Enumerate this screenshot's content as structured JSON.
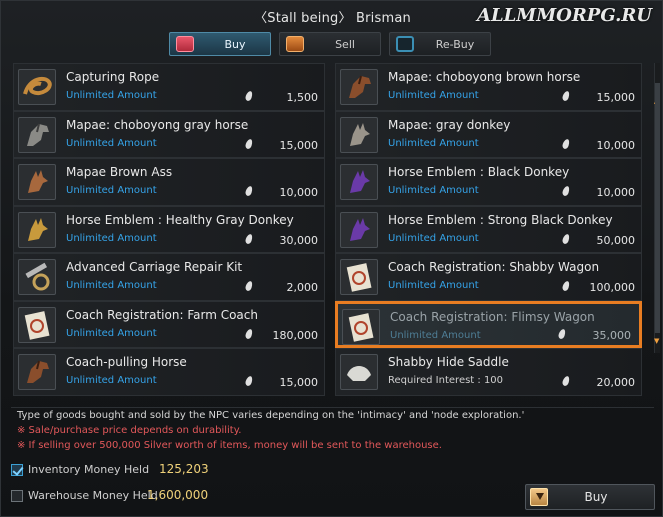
{
  "window": {
    "title": "〈Stall being〉 Brisman",
    "watermark": "ALLMMORPG.RU"
  },
  "tabs": [
    {
      "label": "Buy",
      "icon": "bag-icon",
      "active": true
    },
    {
      "label": "Sell",
      "icon": "coins-icon",
      "active": false
    },
    {
      "label": "Re-Buy",
      "icon": "rebuy-icon",
      "active": false
    }
  ],
  "items_left": [
    {
      "name": "Capturing Rope",
      "sub": "Unlimited Amount",
      "price": "1,500",
      "icon": "rope-icon"
    },
    {
      "name": "Mapae: choboyong gray horse",
      "sub": "Unlimited Amount",
      "price": "15,000",
      "icon": "gray-horse-icon"
    },
    {
      "name": "Mapae Brown Ass",
      "sub": "Unlimited Amount",
      "price": "10,000",
      "icon": "brown-donkey-icon"
    },
    {
      "name": "Horse Emblem : Healthy Gray Donkey",
      "sub": "Unlimited Amount",
      "price": "30,000",
      "icon": "gold-horse-emblem-icon"
    },
    {
      "name": "Advanced Carriage Repair Kit",
      "sub": "Unlimited Amount",
      "price": "2,000",
      "icon": "repair-kit-icon"
    },
    {
      "name": "Coach Registration: Farm Coach",
      "sub": "Unlimited Amount",
      "price": "180,000",
      "icon": "coach-registration-icon"
    },
    {
      "name": "Coach-pulling Horse",
      "sub": "Unlimited Amount",
      "price": "15,000",
      "icon": "brown-horse-icon"
    }
  ],
  "items_right": [
    {
      "name": "Mapae: choboyong brown horse",
      "sub": "Unlimited Amount",
      "price": "15,000",
      "icon": "brown-horse-icon"
    },
    {
      "name": "Mapae: gray donkey",
      "sub": "Unlimited Amount",
      "price": "10,000",
      "icon": "gray-donkey-icon"
    },
    {
      "name": "Horse Emblem : Black Donkey",
      "sub": "Unlimited Amount",
      "price": "10,000",
      "icon": "purple-horse-emblem-icon"
    },
    {
      "name": "Horse Emblem : Strong Black Donkey",
      "sub": "Unlimited Amount",
      "price": "50,000",
      "icon": "purple-horse-emblem-icon"
    },
    {
      "name": "Coach Registration: Shabby Wagon",
      "sub": "Unlimited Amount",
      "price": "100,000",
      "icon": "coach-registration-icon"
    },
    {
      "name": "Coach Registration: Flimsy Wagon",
      "sub": "Unlimited Amount",
      "price": "35,000",
      "icon": "coach-registration-icon",
      "highlight": true
    },
    {
      "name": "Shabby Hide Saddle",
      "sub": "Required Interest : 100",
      "price": "20,000",
      "icon": "saddle-icon"
    }
  ],
  "info": {
    "line1": "Type of goods bought and sold by the NPC varies depending on the 'intimacy' and 'node exploration.'",
    "line2": "※ Sale/purchase price depends on durability.",
    "line3": "※ If selling over 500,000 Silver worth of items, money will be sent to the warehouse."
  },
  "money": {
    "inventory_label": "Inventory Money Held",
    "inventory_value": "125,203",
    "inventory_checked": true,
    "warehouse_label": "Warehouse Money Held",
    "warehouse_value": "1,600,000",
    "warehouse_checked": false
  },
  "buy_button": {
    "label": "Buy",
    "icon": "buy-arrow-icon"
  },
  "colors": {
    "accent": "#35a3e8",
    "highlight": "#e87d22",
    "money": "#f0d27a",
    "warning": "#e2585a"
  }
}
